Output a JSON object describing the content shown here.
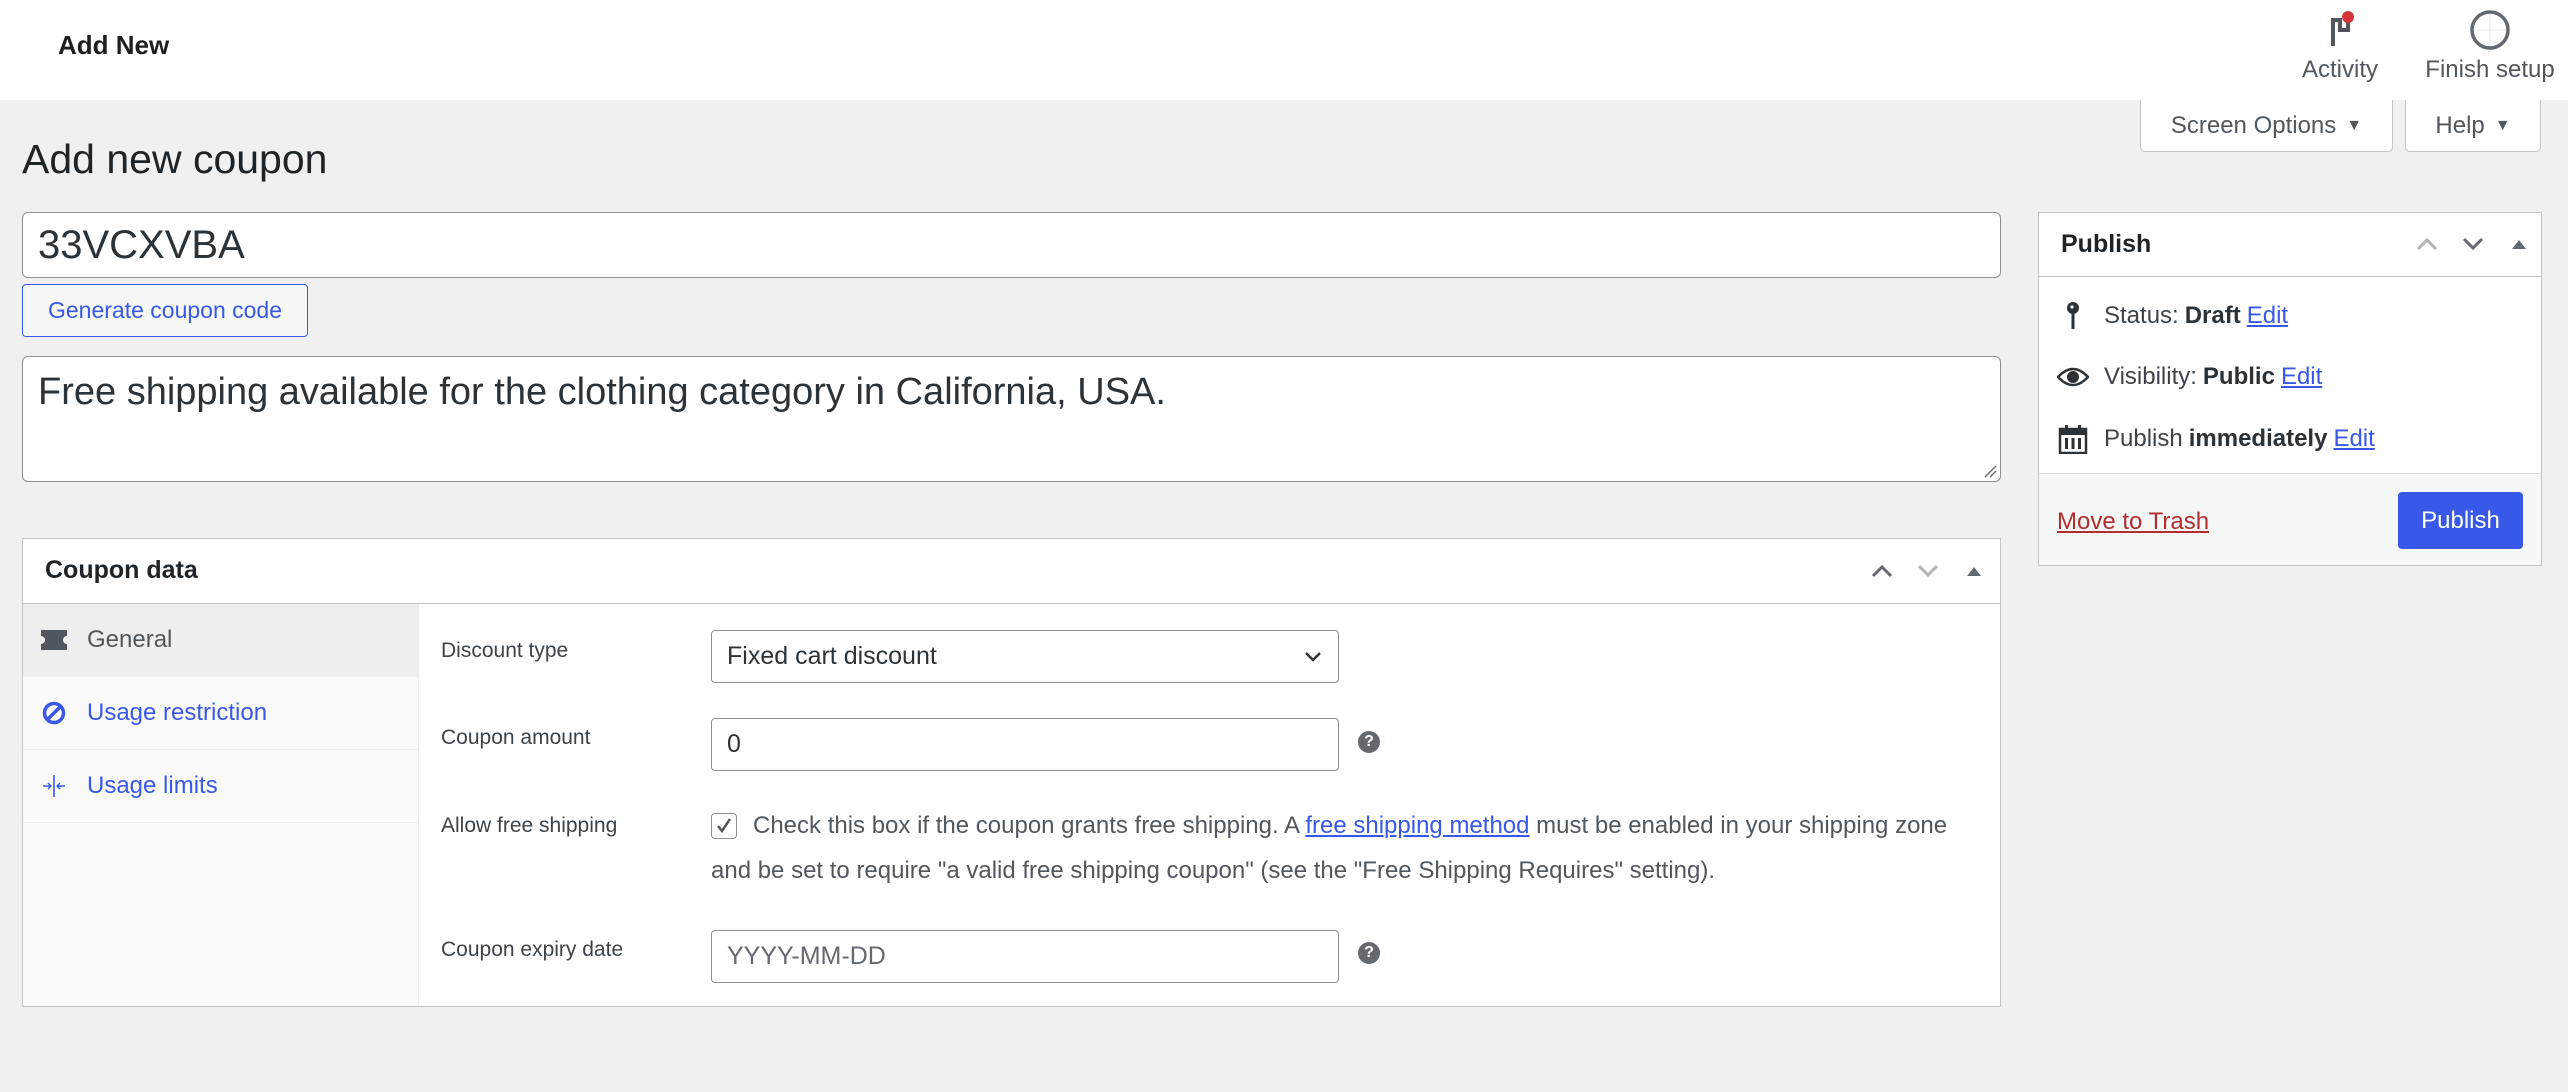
{
  "header": {
    "title": "Add New",
    "activity_label": "Activity",
    "activity_icon": "flag-icon",
    "activity_badge_color": "#d63638",
    "finish_setup_label": "Finish setup",
    "finish_setup_icon": "progress-circle-icon"
  },
  "screen_meta": {
    "screen_options_label": "Screen Options",
    "help_label": "Help"
  },
  "page": {
    "heading": "Add new coupon",
    "coupon_code": "33VCXVBA",
    "generate_button": "Generate coupon code",
    "description": "Free shipping available for the clothing category in California, USA."
  },
  "coupon_data": {
    "title": "Coupon data",
    "tabs": [
      {
        "label": "General",
        "icon": "ticket-icon",
        "active": true
      },
      {
        "label": "Usage restriction",
        "icon": "no-entry-icon",
        "active": false
      },
      {
        "label": "Usage limits",
        "icon": "arrows-in-icon",
        "active": false
      }
    ],
    "fields": {
      "discount_type": {
        "label": "Discount type",
        "value": "Fixed cart discount"
      },
      "coupon_amount": {
        "label": "Coupon amount",
        "value": "0"
      },
      "free_shipping": {
        "label": "Allow free shipping",
        "checked": true,
        "text_before": "Check this box if the coupon grants free shipping. A ",
        "link": "free shipping method",
        "text_after": " must be enabled in your shipping zone and be set to require \"a valid free shipping coupon\" (see the \"Free Shipping Requires\" setting)."
      },
      "expiry_date": {
        "label": "Coupon expiry date",
        "value": "",
        "placeholder": "YYYY-MM-DD"
      }
    }
  },
  "publish": {
    "title": "Publish",
    "status_label": "Status:",
    "status_value": "Draft",
    "visibility_label": "Visibility:",
    "visibility_value": "Public",
    "schedule_label": "Publish",
    "schedule_value": "immediately",
    "edit_label": "Edit",
    "trash_label": "Move to Trash",
    "publish_button": "Publish"
  },
  "colors": {
    "accent": "#3858e9",
    "danger": "#b32d2e",
    "background": "#f0f0f1"
  }
}
